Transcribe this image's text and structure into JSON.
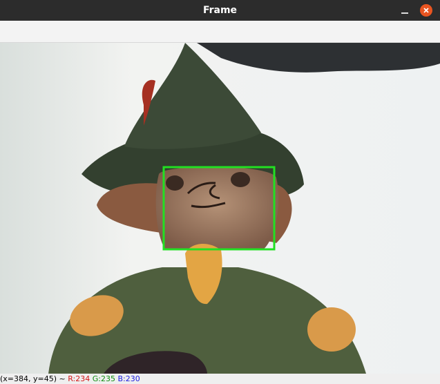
{
  "window": {
    "title": "Frame"
  },
  "icons": {
    "minimize": "minimize-icon",
    "close": "close-icon"
  },
  "colors": {
    "titlebar": "#2c2c2c",
    "close_button": "#e95420",
    "detection_box": "#22e022"
  },
  "status": {
    "coords": "(x=384, y=45) ~",
    "r": "R:234",
    "g": "G:235",
    "b": "B:230"
  }
}
